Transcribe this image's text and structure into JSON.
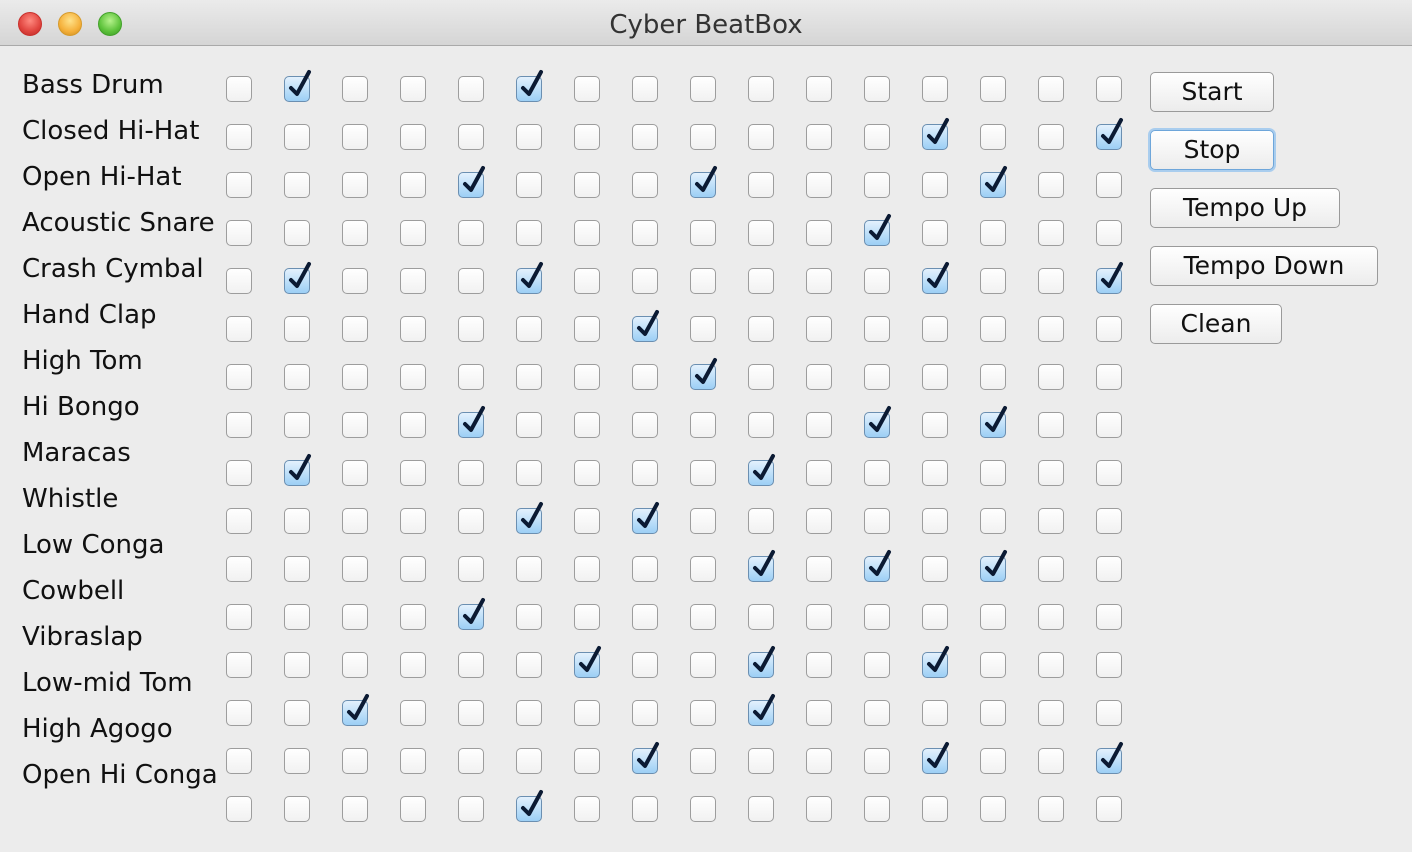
{
  "window": {
    "title": "Cyber BeatBox"
  },
  "instruments": [
    "Bass Drum",
    "Closed Hi-Hat",
    "Open Hi-Hat",
    "Acoustic Snare",
    "Crash Cymbal",
    "Hand Clap",
    "High Tom",
    "Hi Bongo",
    "Maracas",
    "Whistle",
    "Low Conga",
    "Cowbell",
    "Vibraslap",
    "Low-mid Tom",
    "High Agogo",
    "Open Hi Conga"
  ],
  "grid": {
    "rows": 16,
    "cols": 16,
    "checked": [
      [
        0,
        1
      ],
      [
        0,
        5
      ],
      [
        1,
        12
      ],
      [
        1,
        15
      ],
      [
        2,
        4
      ],
      [
        2,
        8
      ],
      [
        2,
        13
      ],
      [
        3,
        11
      ],
      [
        4,
        1
      ],
      [
        4,
        5
      ],
      [
        4,
        12
      ],
      [
        4,
        15
      ],
      [
        5,
        7
      ],
      [
        6,
        8
      ],
      [
        7,
        4
      ],
      [
        7,
        11
      ],
      [
        7,
        13
      ],
      [
        8,
        1
      ],
      [
        8,
        9
      ],
      [
        9,
        5
      ],
      [
        9,
        7
      ],
      [
        10,
        9
      ],
      [
        10,
        11
      ],
      [
        10,
        13
      ],
      [
        11,
        4
      ],
      [
        12,
        6
      ],
      [
        12,
        9
      ],
      [
        12,
        12
      ],
      [
        13,
        2
      ],
      [
        13,
        9
      ],
      [
        14,
        7
      ],
      [
        14,
        12
      ],
      [
        14,
        15
      ],
      [
        15,
        5
      ]
    ]
  },
  "buttons": {
    "start": "Start",
    "stop": "Stop",
    "tempo_up": "Tempo Up",
    "tempo_down": "Tempo Down",
    "clean": "Clean"
  },
  "colors": {
    "check_mark": "#0b1a33",
    "checked_fill": "#9ccff5",
    "focus_ring": "#6ea6da"
  }
}
